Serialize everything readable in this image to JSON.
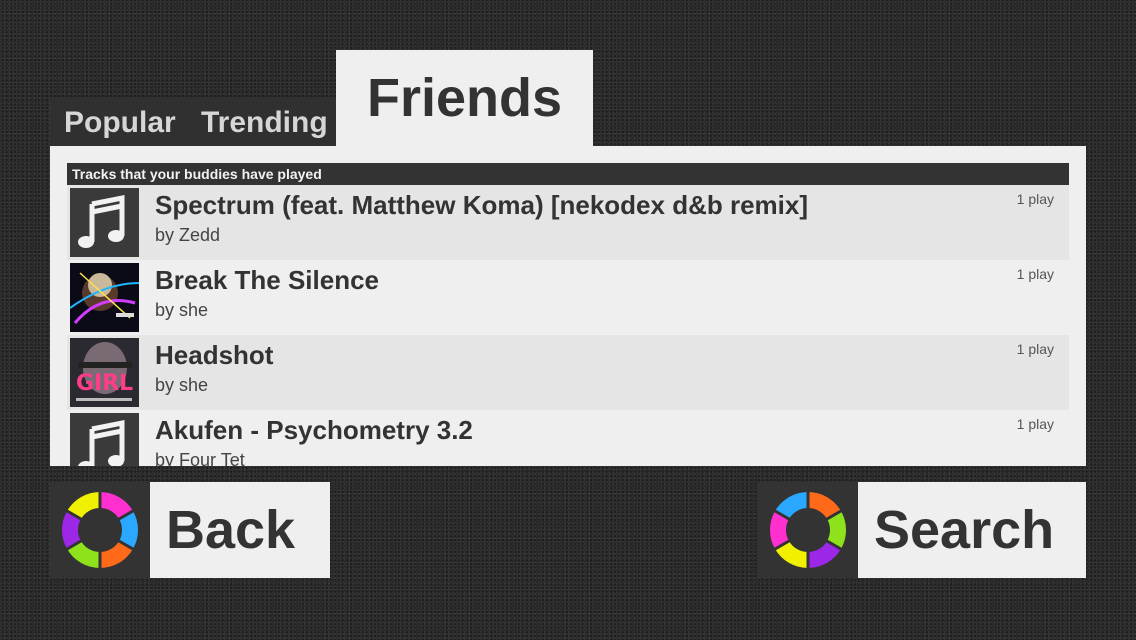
{
  "tabs": {
    "popular": "Popular",
    "trending": "Trending",
    "friends": "Friends"
  },
  "panel": {
    "header": "Tracks that your buddies have played",
    "tracks": [
      {
        "title": "Spectrum (feat. Matthew Koma) [nekodex d&b remix]",
        "artist": "by Zedd",
        "plays": "1 play",
        "art": "music-note"
      },
      {
        "title": "Break The Silence",
        "artist": "by she",
        "plays": "1 play",
        "art": "album-cover"
      },
      {
        "title": "Headshot",
        "artist": "by she",
        "plays": "1 play",
        "art": "album-cover"
      },
      {
        "title": "Akufen - Psychometry 3.2",
        "artist": "by Four Tet",
        "plays": "1 play",
        "art": "music-note"
      }
    ]
  },
  "buttons": {
    "back": "Back",
    "search": "Search",
    "icon": "color-ring-icon"
  },
  "colors": {
    "background": "#262626",
    "panel": "#efefef",
    "dark": "#333333",
    "ring": [
      "#f0f000",
      "#9c27e6",
      "#ff6a1a",
      "#2aa7ff",
      "#ff2fd0",
      "#8ee21c"
    ]
  }
}
